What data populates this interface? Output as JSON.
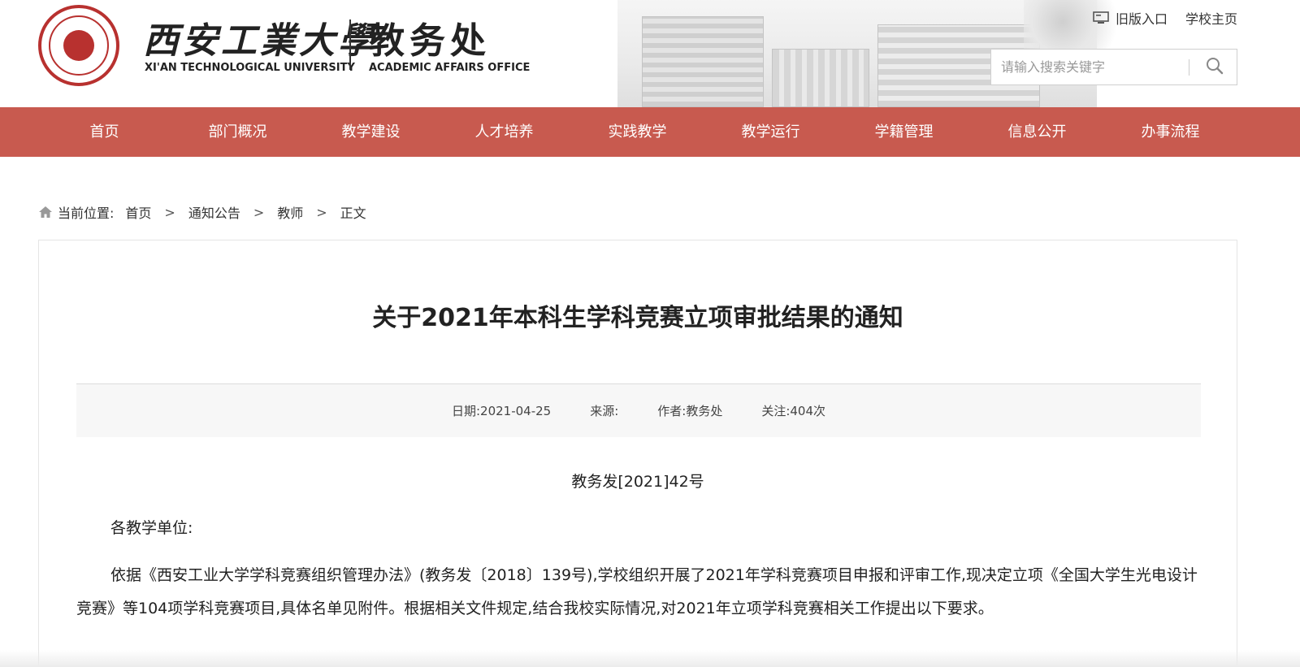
{
  "header": {
    "school_name_cn": "西安工業大學",
    "school_name_en": "XI'AN TECHNOLOGICAL UNIVERSITY",
    "office_name_cn": "教务处",
    "office_name_en": "ACADEMIC AFFAIRS OFFICE",
    "top_links": {
      "old_version": "旧版入口",
      "school_home": "学校主页"
    },
    "search": {
      "placeholder": "请输入搜索关键字"
    }
  },
  "nav": {
    "items": [
      "首页",
      "部门概况",
      "教学建设",
      "人才培养",
      "实践教学",
      "教学运行",
      "学籍管理",
      "信息公开",
      "办事流程"
    ]
  },
  "breadcrumb": {
    "label": "当前位置:",
    "items": [
      "首页",
      "通知公告",
      "教师",
      "正文"
    ],
    "separator": ">"
  },
  "article": {
    "title": "关于2021年本科生学科竞赛立项审批结果的通知",
    "meta": {
      "date": "日期:2021-04-25",
      "source": "来源:",
      "author": "作者:教务处",
      "views": "关注:404次"
    },
    "doc_number": "教务发[2021]42号",
    "salutation": "各教学单位:",
    "body": "依据《西安工业大学学科竞赛组织管理办法》(教务发〔2018〕139号),学校组织开展了2021年学科竞赛项目申报和评审工作,现决定立项《全国大学生光电设计竞赛》等104项学科竞赛项目,具体名单见附件。根据相关文件规定,结合我校实际情况,对2021年立项学科竞赛相关工作提出以下要求。"
  },
  "colors": {
    "nav_bg": "#c85a4f",
    "logo_red": "#b8312f"
  },
  "icons": {
    "monitor": "monitor-icon",
    "search": "search-icon",
    "home": "home-icon"
  }
}
